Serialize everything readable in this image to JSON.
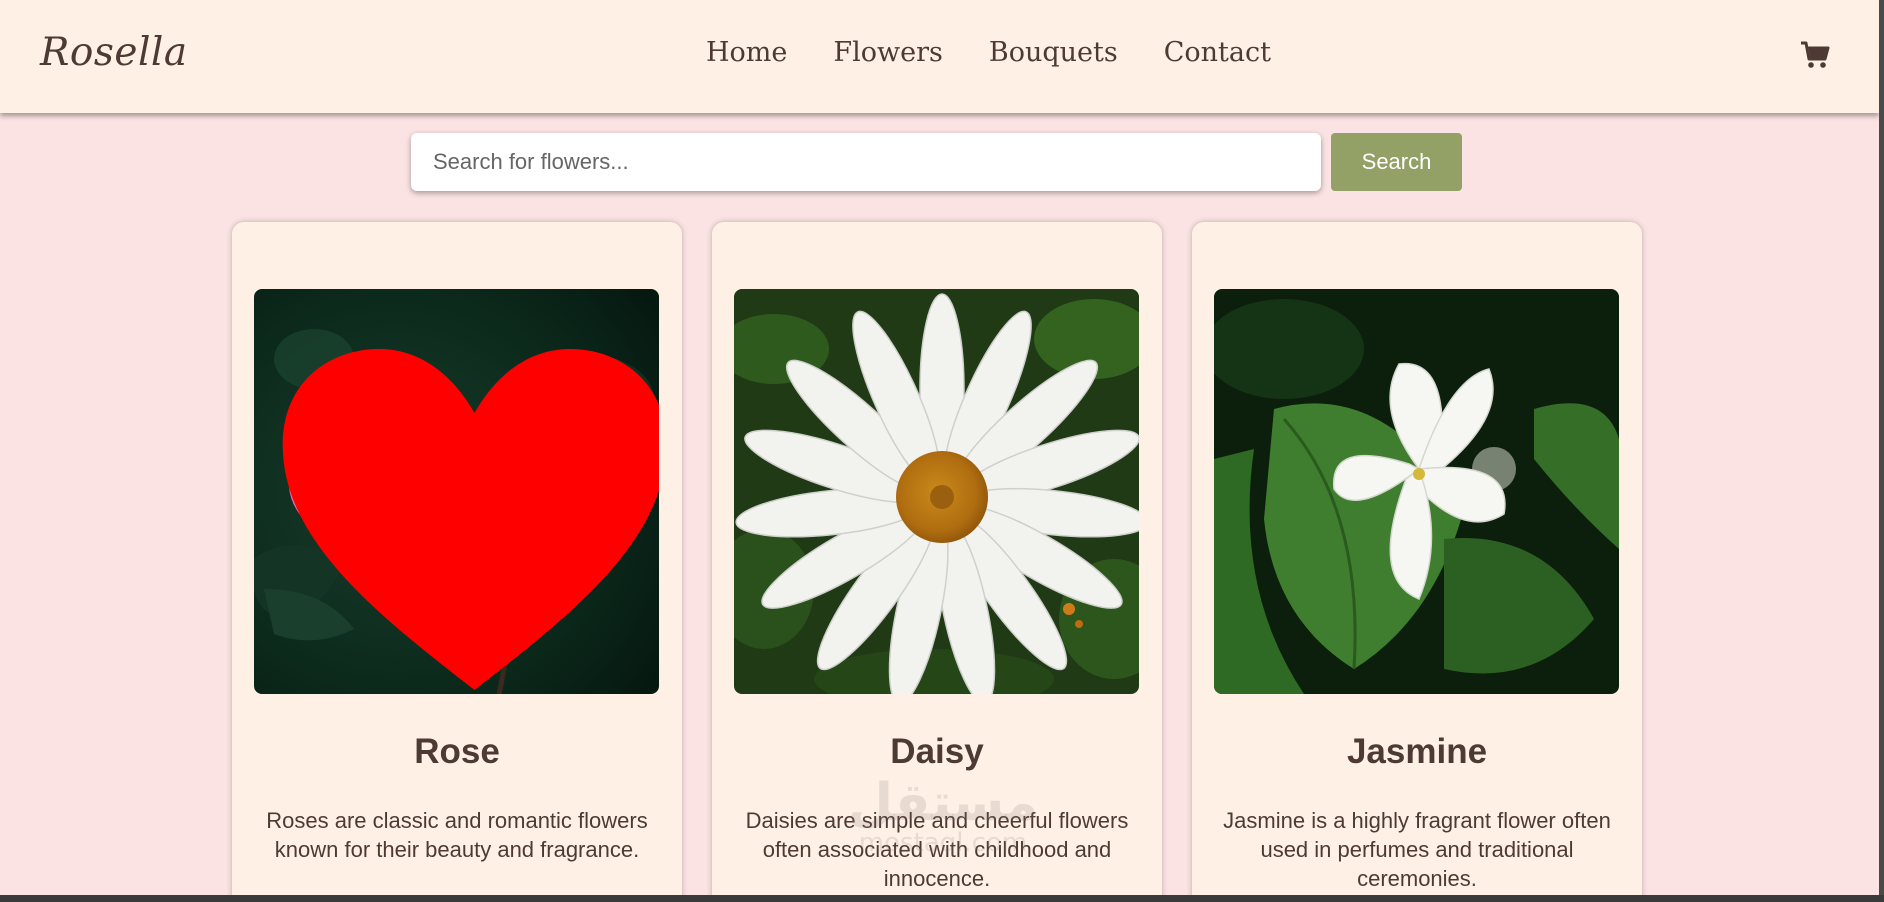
{
  "navbar": {
    "logo": "Rosella",
    "links": [
      "Home",
      "Flowers",
      "Bouquets",
      "Contact"
    ],
    "cart_icon": "shopping-cart-icon"
  },
  "search": {
    "placeholder": "Search for flowers...",
    "button_label": "Search"
  },
  "cards": [
    {
      "title": "Rose",
      "description": "Roses are classic and romantic flowers known for their beauty and fragrance.",
      "favorite_icon": "heart-icon"
    },
    {
      "title": "Daisy",
      "description": "Daisies are simple and cheerful flowers often associated with childhood and innocence."
    },
    {
      "title": "Jasmine",
      "description": "Jasmine is a highly fragrant flower often used in perfumes and traditional ceremonies."
    }
  ],
  "watermark": {
    "arabic": "مستقل",
    "latin": "mostaql.com"
  },
  "colors": {
    "page_background": "#fbe3e3",
    "card_background": "#fff0e5",
    "accent_green": "#93a066",
    "text_brown": "#4e3a34",
    "heart_red": "#ff0000"
  }
}
